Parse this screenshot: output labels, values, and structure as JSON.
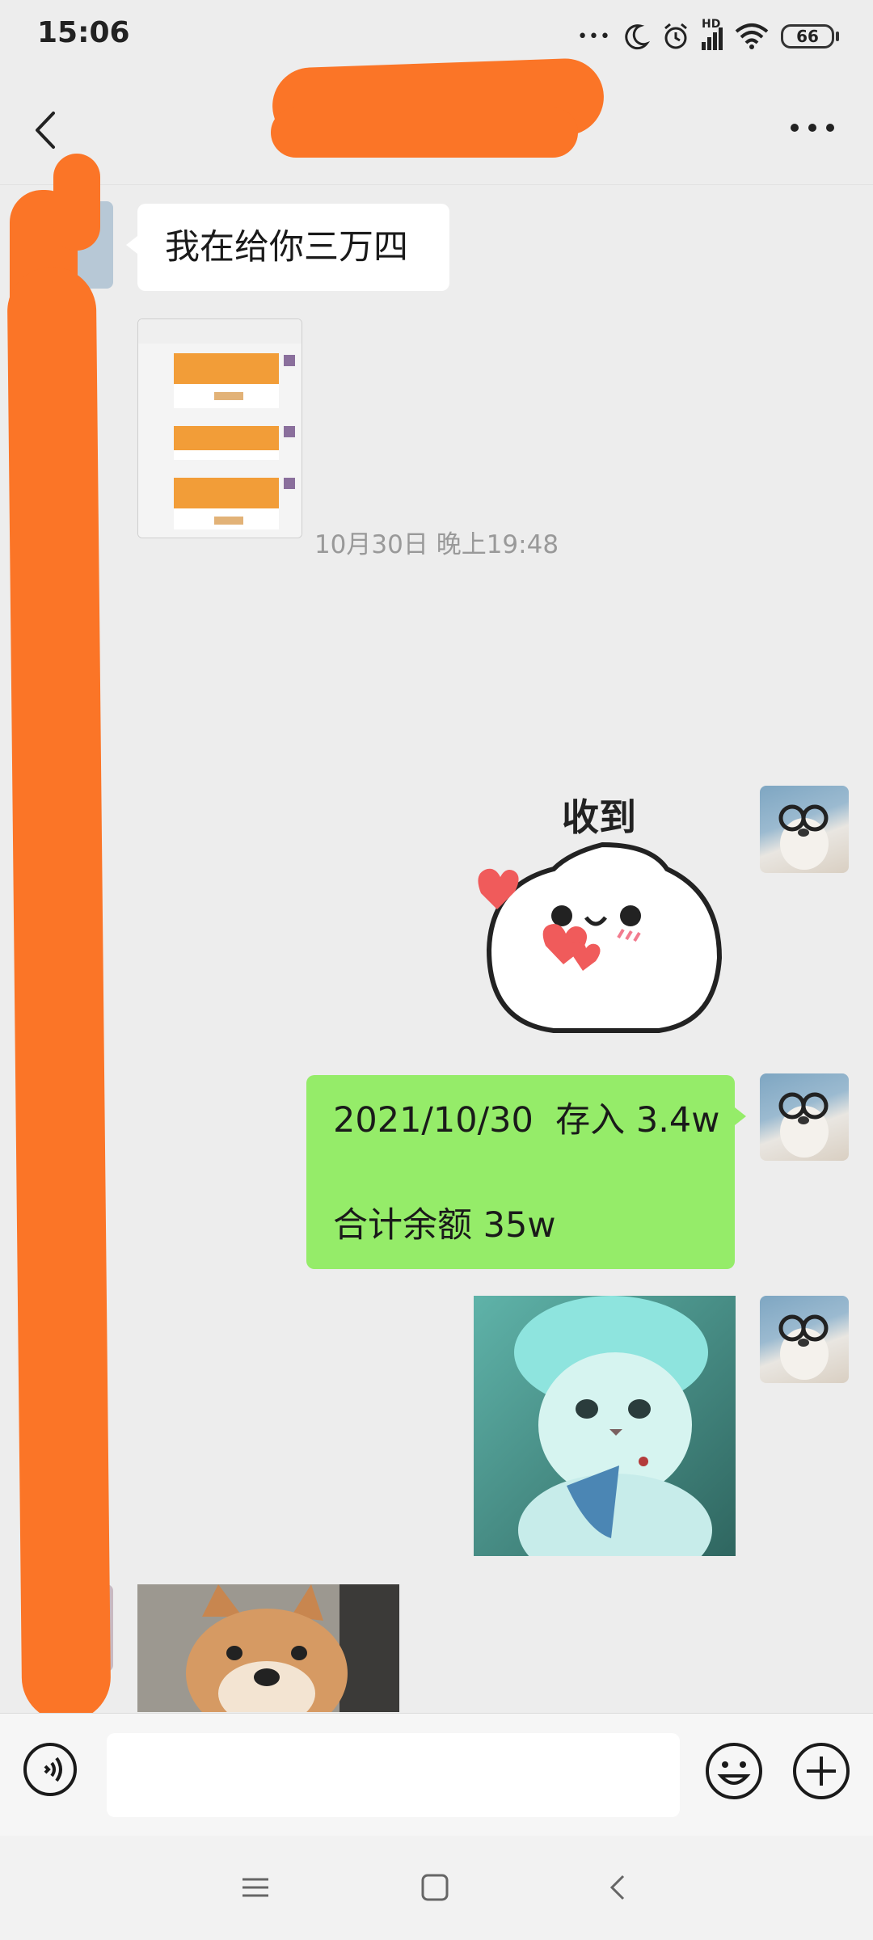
{
  "status_bar": {
    "time": "15:06",
    "more_dots": "•••",
    "network": "HD",
    "battery": "66"
  },
  "chat": {
    "messages": [
      {
        "side": "in",
        "type": "text",
        "text": "我在给你三万四"
      },
      {
        "side": "in",
        "type": "image",
        "icon": "screenshot-thumbnail"
      },
      {
        "side": "out",
        "type": "sticker",
        "text": "收到"
      },
      {
        "side": "out",
        "type": "text",
        "lines": [
          "2021/10/30  存入 3.4w",
          "合计余额 35w"
        ]
      },
      {
        "side": "out",
        "type": "image",
        "icon": "cat-photo"
      },
      {
        "side": "in",
        "type": "image",
        "icon": "shiba-photo"
      }
    ],
    "timestamp": "10月30日 晚上19:48"
  },
  "input": {
    "placeholder": ""
  },
  "colors": {
    "outgoing_bubble": "#95ec69",
    "incoming_bubble": "#ffffff",
    "chat_background": "#ededed",
    "redaction": "#fb7527"
  }
}
